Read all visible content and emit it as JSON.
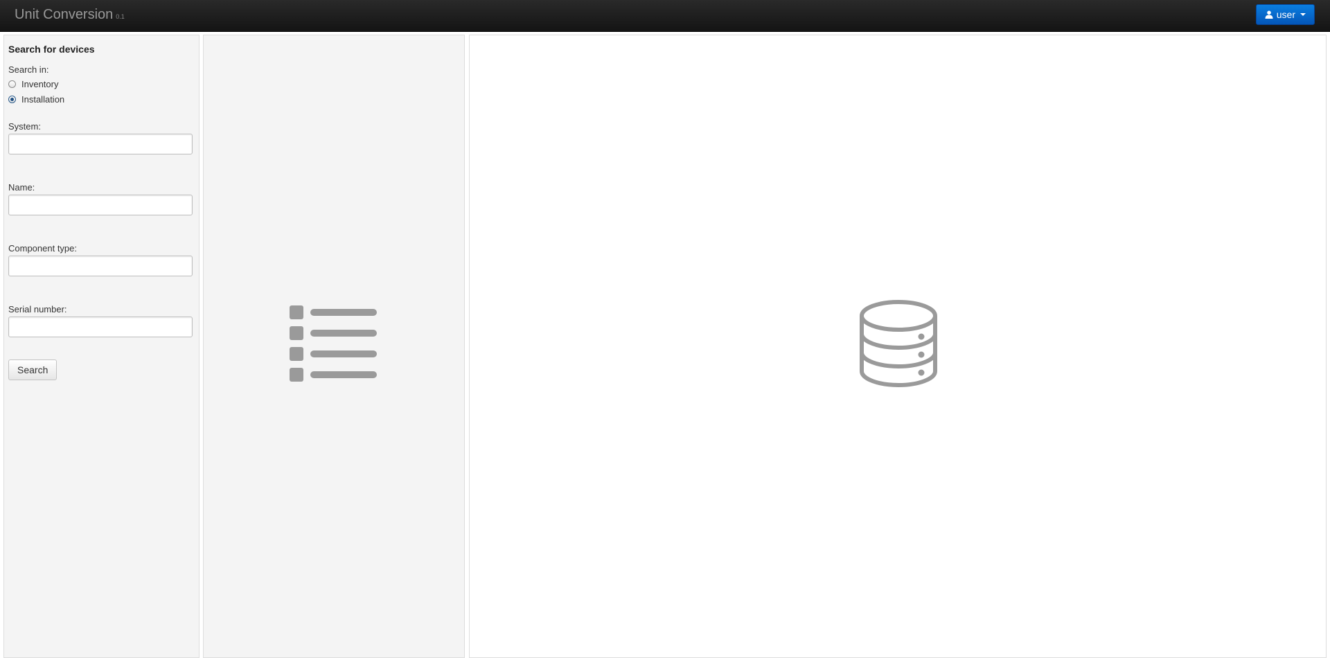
{
  "app": {
    "title": "Unit Conversion",
    "version": "0.1"
  },
  "user_menu": {
    "label": "user",
    "icon": "user-icon"
  },
  "search": {
    "title": "Search for devices",
    "search_in_label": "Search in:",
    "options": [
      {
        "label": "Inventory",
        "checked": false
      },
      {
        "label": "Installation",
        "checked": true
      }
    ],
    "fields": [
      {
        "label": "System:",
        "value": ""
      },
      {
        "label": "Name:",
        "value": ""
      },
      {
        "label": "Component type:",
        "value": ""
      },
      {
        "label": "Serial number:",
        "value": ""
      }
    ],
    "button_label": "Search"
  },
  "list_panel": {
    "icon": "list-icon"
  },
  "detail_panel": {
    "icon": "database-icon"
  },
  "colors": {
    "navbar": "#1b1b1b",
    "brand_text": "#999999",
    "user_button": "#0668cd",
    "panel_bg": "#f4f4f4",
    "placeholder_icon": "#999999"
  }
}
